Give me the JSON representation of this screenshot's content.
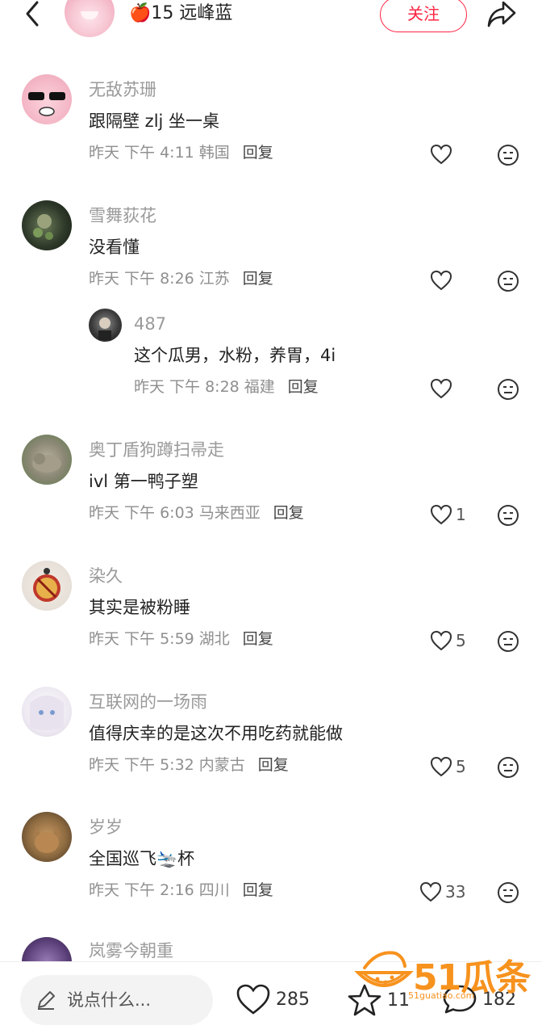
{
  "header": {
    "author_name": "🍎15 远峰蓝",
    "follow_label": "关注"
  },
  "comments": [
    {
      "user": "无敌苏珊",
      "text": "跟隔壁 zlj 坐一桌",
      "meta": "昨天 下午 4:11 韩国",
      "reply": "回复",
      "likes": ""
    },
    {
      "user": "雪舞荻花",
      "text": "没看懂",
      "meta": "昨天 下午 8:26 江苏",
      "reply": "回复",
      "likes": ""
    },
    {
      "user": "487",
      "text": "这个瓜男，水粉，养胃，4i",
      "meta": "昨天 下午 8:28 福建",
      "reply": "回复",
      "likes": ""
    },
    {
      "user": "奥丁盾狗蹲扫帚走",
      "text": "ivl 第一鸭子塑",
      "meta": "昨天 下午 6:03 马来西亚",
      "reply": "回复",
      "likes": "1"
    },
    {
      "user": "染久",
      "text": "其实是被粉睡",
      "meta": "昨天 下午 5:59 湖北",
      "reply": "回复",
      "likes": "5"
    },
    {
      "user": "互联网的一场雨",
      "text": "值得庆幸的是这次不用吃药就能做",
      "meta": "昨天 下午 5:32 内蒙古",
      "reply": "回复",
      "likes": "5"
    },
    {
      "user": "岁岁",
      "text": "全国巡飞🛬杯",
      "meta": "昨天 下午 2:16 四川",
      "reply": "回复",
      "likes": "33"
    },
    {
      "user": "岚雾今朝重"
    }
  ],
  "bottom_bar": {
    "input_placeholder": "说点什么...",
    "likes": "285",
    "stars": "11",
    "comments": "182"
  },
  "watermark": {
    "main": "51瓜条",
    "sub": "51guatiao.com"
  },
  "colors": {
    "accent": "#ff2442",
    "username_gray": "#9a9a9a",
    "watermark_orange": "#f7921e"
  }
}
